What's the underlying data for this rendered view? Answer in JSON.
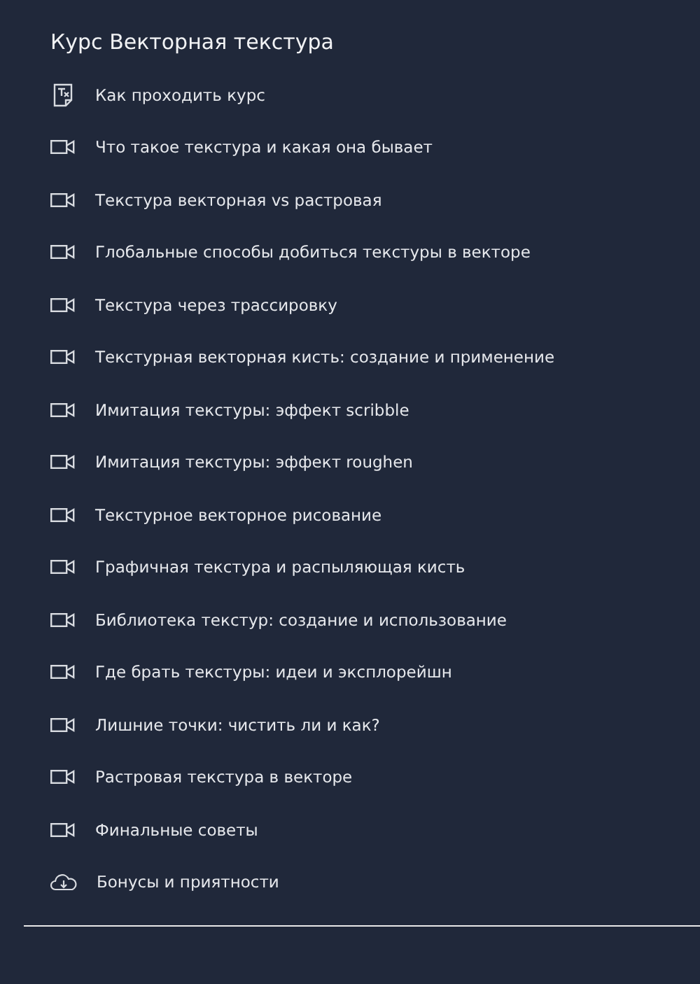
{
  "course": {
    "title": "Курс Векторная текстура",
    "lessons": [
      {
        "kind": "text",
        "label": "Как проходить курс"
      },
      {
        "kind": "video",
        "label": "Что такое текстура и какая она бывает"
      },
      {
        "kind": "video",
        "label": "Текстура векторная vs растровая"
      },
      {
        "kind": "video",
        "label": "Глобальные способы добиться текстуры в векторе"
      },
      {
        "kind": "video",
        "label": "Текстура через трассировку"
      },
      {
        "kind": "video",
        "label": "Текстурная векторная кисть: создание и применение"
      },
      {
        "kind": "video",
        "label": "Имитация текстуры: эффект scribble"
      },
      {
        "kind": "video",
        "label": "Имитация текстуры: эффект roughen"
      },
      {
        "kind": "video",
        "label": "Текстурное векторное рисование"
      },
      {
        "kind": "video",
        "label": "Графичная текстура и распыляющая кисть"
      },
      {
        "kind": "video",
        "label": "Библиотека текстур: создание и использование"
      },
      {
        "kind": "video",
        "label": "Где брать текстуры: идеи и эксплорейшн"
      },
      {
        "kind": "video",
        "label": "Лишние точки: чистить ли и как?"
      },
      {
        "kind": "video",
        "label": "Растровая текстура в векторе"
      },
      {
        "kind": "video",
        "label": "Финальные советы"
      },
      {
        "kind": "download",
        "label": "Бонусы и приятности"
      }
    ]
  }
}
